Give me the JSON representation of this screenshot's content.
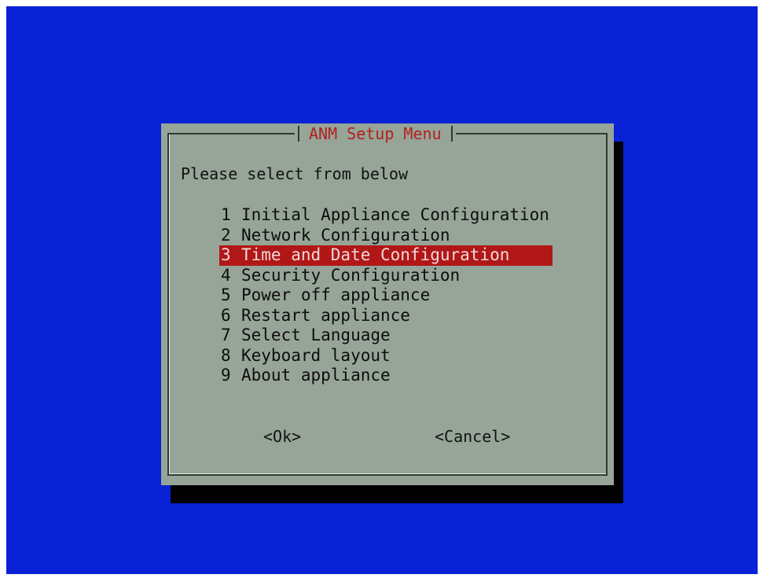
{
  "dialog": {
    "title": "ANM Setup Menu",
    "prompt": "Please select from below",
    "menu_items": [
      {
        "number": "1",
        "label": "Initial Appliance Configuration"
      },
      {
        "number": "2",
        "label": "Network Configuration"
      },
      {
        "number": "3",
        "label": "Time and Date Configuration"
      },
      {
        "number": "4",
        "label": "Security Configuration"
      },
      {
        "number": "5",
        "label": "Power off appliance"
      },
      {
        "number": "6",
        "label": "Restart appliance"
      },
      {
        "number": "7",
        "label": "Select Language"
      },
      {
        "number": "8",
        "label": "Keyboard layout"
      },
      {
        "number": "9",
        "label": "About appliance"
      }
    ],
    "selected_index": 2,
    "ok_label": "<Ok>",
    "cancel_label": "<Cancel>"
  },
  "colors": {
    "background": "#0a22d6",
    "dialog": "#96a598",
    "highlight": "#b11717",
    "title": "#b31f1f"
  }
}
